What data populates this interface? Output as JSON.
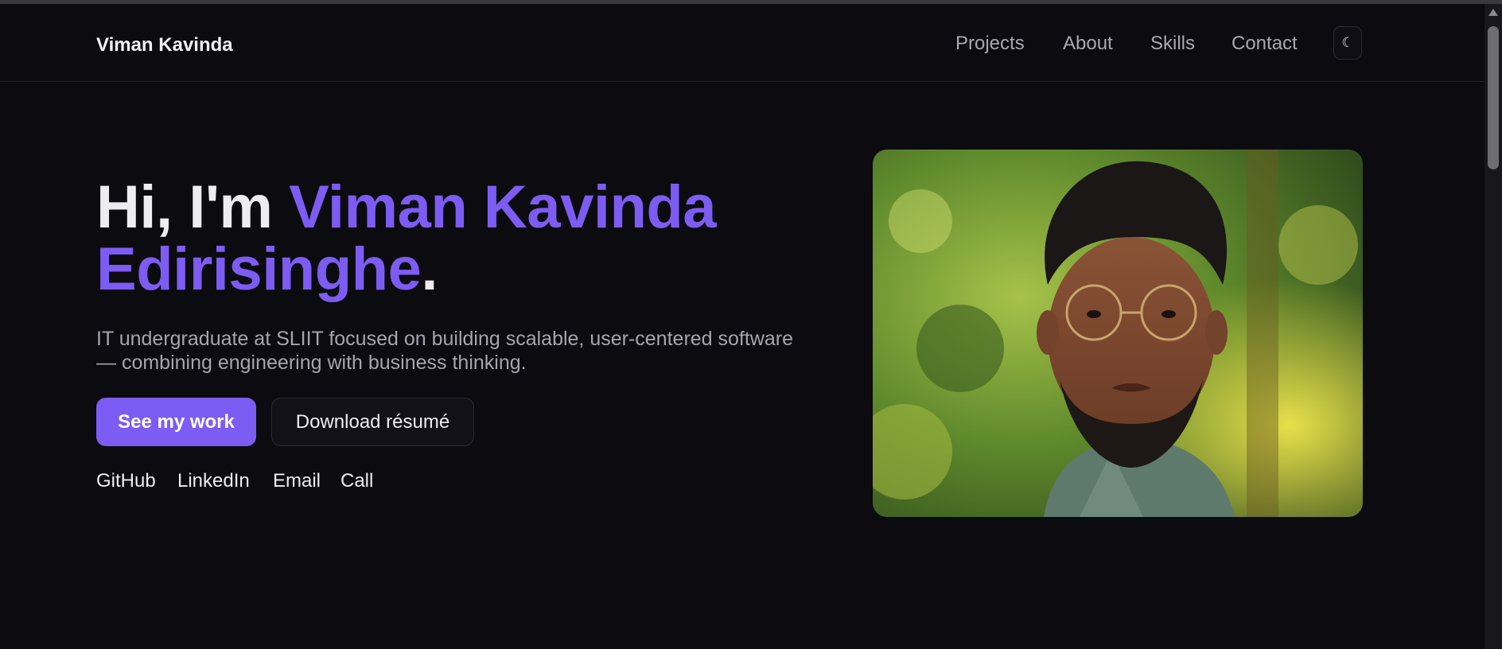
{
  "header": {
    "brand": "Viman Kavinda",
    "nav": [
      {
        "label": "Projects"
      },
      {
        "label": "About"
      },
      {
        "label": "Skills"
      },
      {
        "label": "Contact"
      }
    ],
    "theme_toggle_icon": "☾"
  },
  "hero": {
    "title_prefix": "Hi, I'm ",
    "title_name_line1": "Viman Kavinda",
    "title_name_line2": "Edirisinghe",
    "title_suffix": ".",
    "subtitle": "IT undergraduate at SLIIT focused on building scalable, user-centered software — combining engineering with business thinking.",
    "primary_button": "See my work",
    "secondary_button": "Download résumé",
    "links": [
      {
        "label": "GitHub"
      },
      {
        "label": "LinkedIn"
      },
      {
        "label": "Email"
      },
      {
        "label": "Call"
      }
    ]
  },
  "colors": {
    "background": "#0c0b10",
    "accent": "#7c5cf2",
    "text": "#ececf1",
    "muted": "#a6a5ae"
  },
  "icons": {
    "theme_toggle": "moon-icon",
    "scroll_up": "scroll-up-arrow-icon"
  }
}
